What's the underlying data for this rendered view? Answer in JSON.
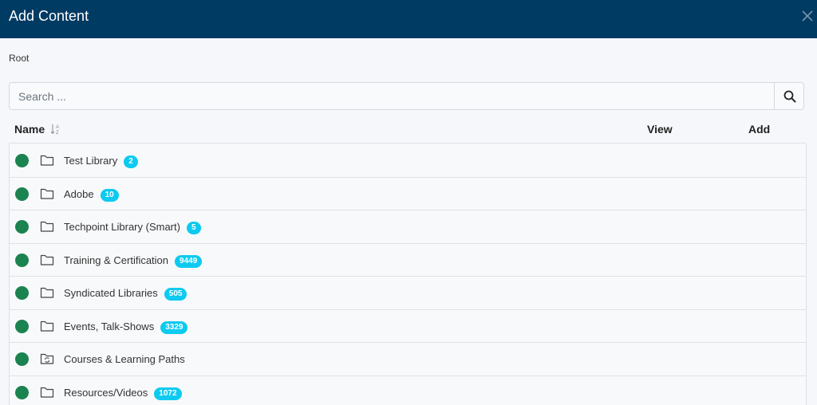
{
  "modal": {
    "title": "Add Content"
  },
  "breadcrumb": {
    "root": "Root"
  },
  "search": {
    "placeholder": "Search ..."
  },
  "table": {
    "headers": {
      "name": "Name",
      "view": "View",
      "add": "Add"
    },
    "rows": [
      {
        "label": "Test Library",
        "count": "2",
        "icon": "folder-icon",
        "status": "active"
      },
      {
        "label": "Adobe",
        "count": "10",
        "icon": "folder-icon",
        "status": "active"
      },
      {
        "label": "Techpoint Library (Smart)",
        "count": "5",
        "icon": "folder-icon",
        "status": "active"
      },
      {
        "label": "Training & Certification",
        "count": "9449",
        "icon": "folder-icon",
        "status": "active"
      },
      {
        "label": "Syndicated Libraries",
        "count": "505",
        "icon": "folder-icon",
        "status": "active"
      },
      {
        "label": "Events, Talk-Shows",
        "count": "3329",
        "icon": "folder-icon",
        "status": "active"
      },
      {
        "label": "Courses & Learning Paths",
        "count": "",
        "icon": "synced-folder-icon",
        "status": "active"
      },
      {
        "label": "Resources/Videos",
        "count": "1072",
        "icon": "folder-icon",
        "status": "active"
      }
    ]
  },
  "colors": {
    "header_bg": "#003b63",
    "status_active": "#1b8350",
    "badge": "#0dcaf0"
  }
}
